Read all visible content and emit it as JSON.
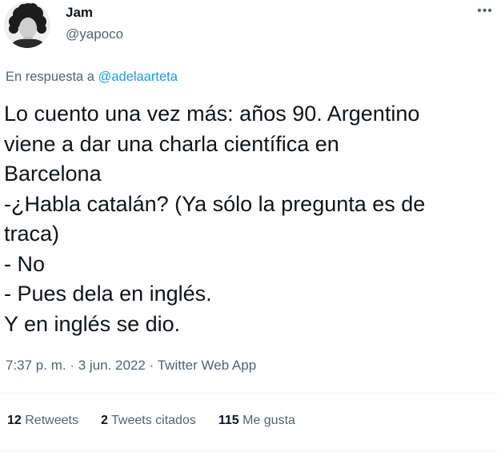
{
  "author": {
    "display_name": "Jam",
    "handle": "@yapoco"
  },
  "more_icon": "•••",
  "reply": {
    "prefix": "En respuesta a",
    "mention": "@adelaarteta"
  },
  "tweet": {
    "lines": [
      "Lo cuento una vez más: años 90. Argentino",
      "viene a dar una charla científica en",
      "Barcelona",
      "-¿Habla catalán? (Ya sólo la pregunta es de",
      "traca)",
      "- No",
      "- Pues dela en inglés.",
      "Y en inglés se dio."
    ]
  },
  "meta": {
    "time": "7:37 p. m.",
    "separator": "·",
    "date": "3 jun. 2022",
    "source": "Twitter Web App"
  },
  "stats": {
    "retweets_count": "12",
    "retweets_label": "Retweets",
    "quotes_count": "2",
    "quotes_label": "Tweets citados",
    "likes_count": "115",
    "likes_label": "Me gusta"
  },
  "colors": {
    "text": "#0f1419",
    "secondary": "#536471",
    "link": "#1d9bf0",
    "divider": "#eff3f4"
  }
}
